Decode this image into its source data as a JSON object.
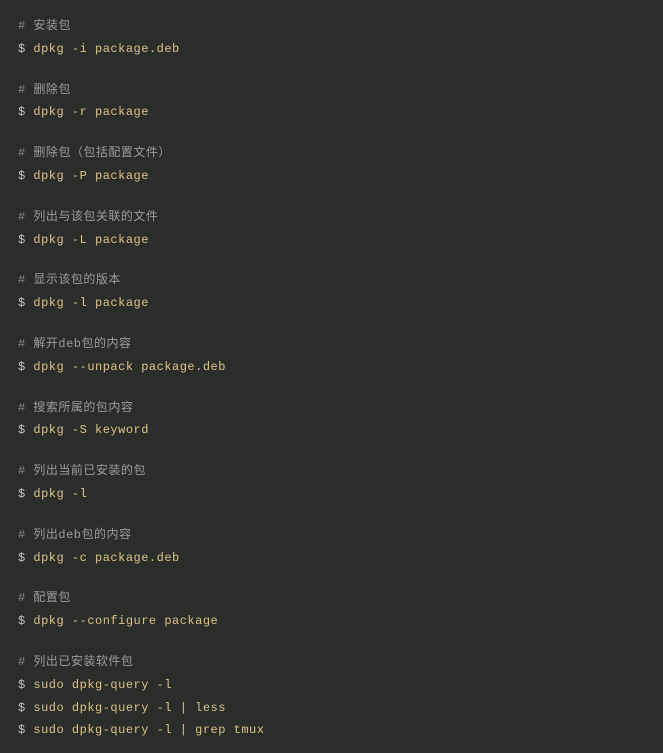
{
  "blocks": [
    {
      "comment": {
        "hash": "#",
        "text": " 安装包"
      },
      "commands": [
        {
          "prompt": "$",
          "cmd": " dpkg -i package.deb"
        }
      ]
    },
    {
      "comment": {
        "hash": "#",
        "text": " 删除包"
      },
      "commands": [
        {
          "prompt": "$",
          "cmd": " dpkg -r package"
        }
      ]
    },
    {
      "comment": {
        "hash": "#",
        "text": " 删除包（包括配置文件）"
      },
      "commands": [
        {
          "prompt": "$",
          "cmd": " dpkg -P package"
        }
      ]
    },
    {
      "comment": {
        "hash": "#",
        "text": " 列出与该包关联的文件"
      },
      "commands": [
        {
          "prompt": "$",
          "cmd": " dpkg -L package"
        }
      ]
    },
    {
      "comment": {
        "hash": "#",
        "text": " 显示该包的版本"
      },
      "commands": [
        {
          "prompt": "$",
          "cmd": " dpkg -l package"
        }
      ]
    },
    {
      "comment": {
        "hash": "#",
        "text": " 解开deb包的内容"
      },
      "commands": [
        {
          "prompt": "$",
          "cmd": " dpkg --unpack package.deb"
        }
      ]
    },
    {
      "comment": {
        "hash": "#",
        "text": " 搜索所属的包内容"
      },
      "commands": [
        {
          "prompt": "$",
          "cmd": " dpkg -S keyword"
        }
      ]
    },
    {
      "comment": {
        "hash": "#",
        "text": " 列出当前已安装的包"
      },
      "commands": [
        {
          "prompt": "$",
          "cmd": " dpkg -l"
        }
      ]
    },
    {
      "comment": {
        "hash": "#",
        "text": " 列出deb包的内容"
      },
      "commands": [
        {
          "prompt": "$",
          "cmd": " dpkg -c package.deb"
        }
      ]
    },
    {
      "comment": {
        "hash": "#",
        "text": " 配置包"
      },
      "commands": [
        {
          "prompt": "$",
          "cmd": " dpkg --configure package"
        }
      ]
    },
    {
      "comment": {
        "hash": "#",
        "text": " 列出已安装软件包"
      },
      "commands": [
        {
          "prompt": "$",
          "cmd": " sudo dpkg-query -l"
        },
        {
          "prompt": "$",
          "cmd": " sudo dpkg-query -l | less"
        },
        {
          "prompt": "$",
          "cmd": " sudo dpkg-query -l | grep tmux"
        }
      ]
    }
  ]
}
